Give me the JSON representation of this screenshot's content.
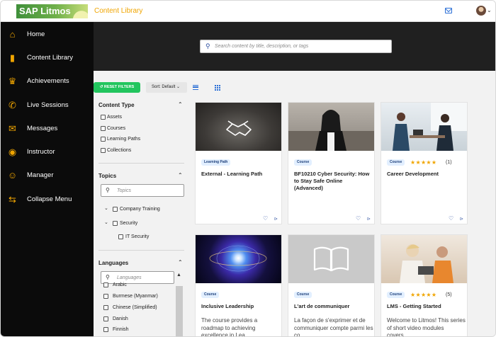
{
  "app": {
    "logo_text": "SAP Litmos",
    "breadcrumb": "Content Library"
  },
  "header": {
    "mail_icon": "mail-icon",
    "avatar_icon": "avatar"
  },
  "sidebar": {
    "items": [
      {
        "label": "Home",
        "icon": "home-icon",
        "glyph": "⌂"
      },
      {
        "label": "Content Library",
        "icon": "library-icon",
        "glyph": "▮"
      },
      {
        "label": "Achievements",
        "icon": "trophy-icon",
        "glyph": "♛"
      },
      {
        "label": "Live Sessions",
        "icon": "live-sessions-icon",
        "glyph": "✆"
      },
      {
        "label": "Messages",
        "icon": "messages-icon",
        "glyph": "✉"
      },
      {
        "label": "Instructor",
        "icon": "instructor-icon",
        "glyph": "◉"
      },
      {
        "label": "Manager",
        "icon": "manager-icon",
        "glyph": "☺"
      },
      {
        "label": "Collapse Menu",
        "icon": "collapse-icon",
        "glyph": "⇆"
      }
    ]
  },
  "search": {
    "placeholder": "Search content by title, description, or tags"
  },
  "toolbar": {
    "reset_label": "RESET FILTERS",
    "sort_label": "Sort: Default"
  },
  "filters": {
    "content_type": {
      "title": "Content Type",
      "options": [
        "Assets",
        "Courses",
        "Learning Paths",
        "Collections"
      ]
    },
    "topics": {
      "title": "Topics",
      "placeholder": "Topics",
      "tree": [
        "Company Training",
        "Security",
        "IT Security"
      ]
    },
    "languages": {
      "title": "Languages",
      "placeholder": "Languages",
      "options": [
        "Arabic",
        "Burmese (Myanmar)",
        "Chinese (Simplified)",
        "Danish",
        "Finnish"
      ]
    }
  },
  "cards": [
    {
      "tag": "Learning Path",
      "title": "External - Learning Path",
      "description": "",
      "rating": null,
      "rating_count": ""
    },
    {
      "tag": "Course",
      "title": "BF10210 Cyber Security: How to Stay Safe Online (Advanced)",
      "description": "",
      "rating": null,
      "rating_count": ""
    },
    {
      "tag": "Course",
      "title": "Career Development",
      "description": "",
      "rating": 5,
      "rating_count": "(1)"
    },
    {
      "tag": "Course",
      "title": "Inclusive Leadership",
      "description": "The course provides a roadmap to achieving excellence in Lea...",
      "rating": null,
      "rating_count": ""
    },
    {
      "tag": "Course",
      "title": "L'art de communiquer",
      "description": "La façon de s'exprimer et de communiquer compte parmi les co...",
      "rating": null,
      "rating_count": ""
    },
    {
      "tag": "Course",
      "title": "LMS - Getting Started",
      "description": "Welcome to Litmos! This series of short video modules covers...",
      "rating": 5,
      "rating_count": "(5)"
    }
  ],
  "colors": {
    "accent": "#f0a500",
    "reset": "#22c55e",
    "link": "#2b6fd6",
    "sidebar": "#0b0b0b"
  }
}
